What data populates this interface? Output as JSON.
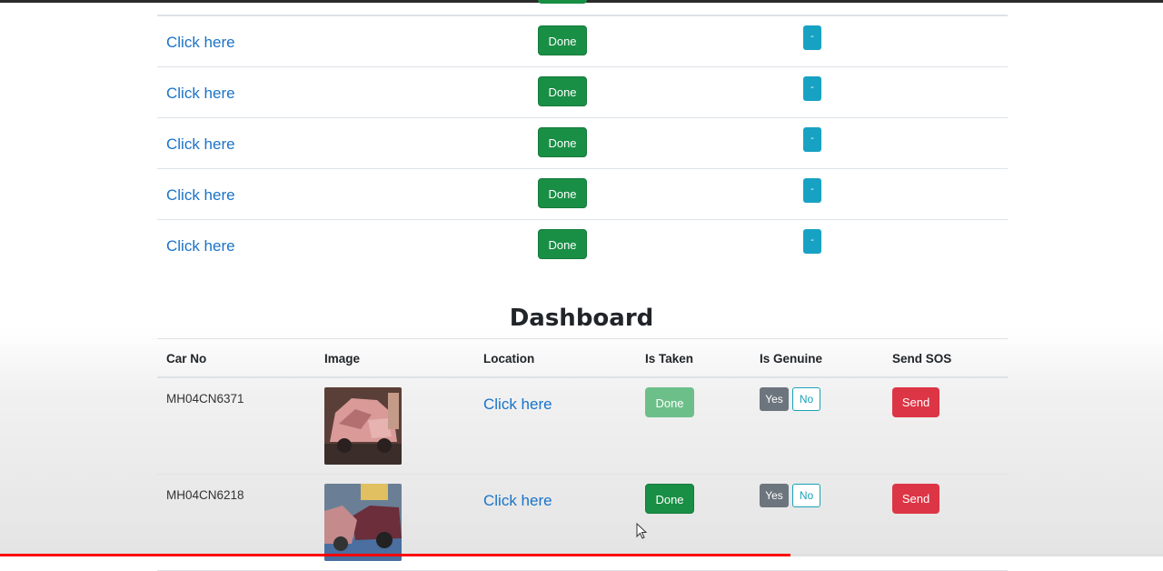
{
  "upper_table": {
    "rows": [
      {
        "link": "Click here",
        "done": "Done",
        "info": "-"
      },
      {
        "link": "Click here",
        "done": "Done",
        "info": "-"
      },
      {
        "link": "Click here",
        "done": "Done",
        "info": "-"
      },
      {
        "link": "Click here",
        "done": "Done",
        "info": "-"
      },
      {
        "link": "Click here",
        "done": "Done",
        "info": "-"
      }
    ]
  },
  "dashboard": {
    "title": "Dashboard",
    "columns": [
      "Car No",
      "Image",
      "Location",
      "Is Taken",
      "Is Genuine",
      "Send SOS"
    ],
    "rows": [
      {
        "car_no": "MH04CN6371",
        "location": "Click here",
        "is_taken": "Done",
        "yes": "Yes",
        "no": "No",
        "send": "Send"
      },
      {
        "car_no": "MH04CN6218",
        "location": "Click here",
        "is_taken": "Done",
        "yes": "Yes",
        "no": "No",
        "send": "Send"
      }
    ]
  },
  "video_progress": 0.68,
  "colors": {
    "success": "#198f45",
    "info": "#17a2c4",
    "danger": "#dc3545",
    "link": "#1a73c8",
    "secondary": "#6c757d"
  }
}
